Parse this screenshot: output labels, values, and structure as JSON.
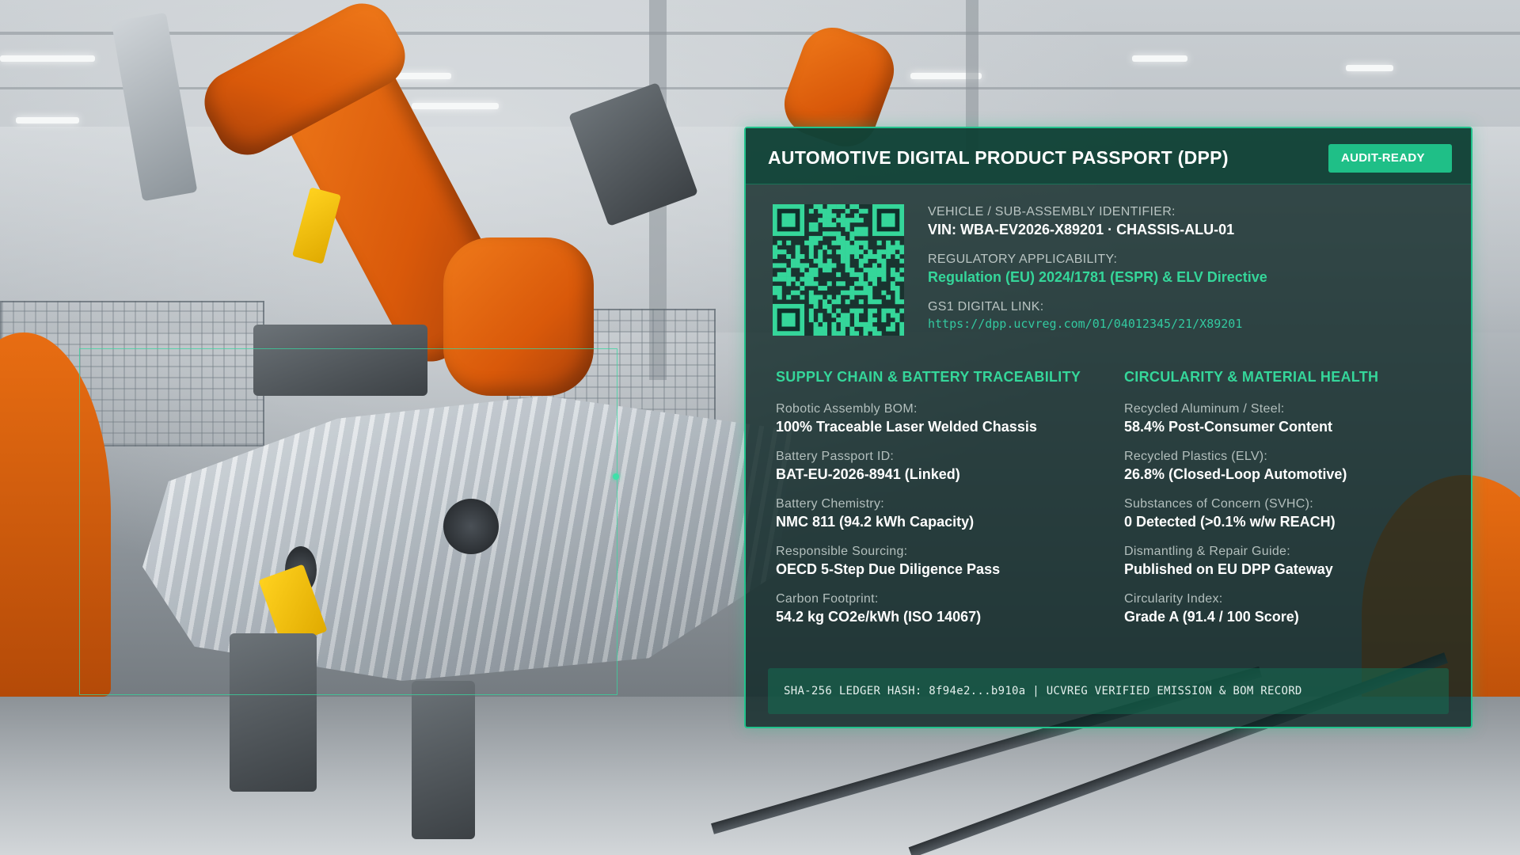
{
  "panel": {
    "title": "AUTOMOTIVE DIGITAL PRODUCT PASSPORT (DPP)",
    "badge": "AUDIT-READY",
    "identity": {
      "vehicle_label": "VEHICLE / SUB-ASSEMBLY IDENTIFIER:",
      "vehicle_value": "VIN: WBA-EV2026-X89201 · CHASSIS-ALU-01",
      "regulatory_label": "REGULATORY APPLICABILITY:",
      "regulatory_value": "Regulation (EU) 2024/1781 (ESPR) & ELV Directive",
      "gs1_label": "GS1 DIGITAL LINK:",
      "gs1_value": "https://dpp.ucvreg.com/01/04012345/21/X89201"
    },
    "supply_chain": {
      "title": "SUPPLY CHAIN & BATTERY TRACEABILITY",
      "items": [
        {
          "label": "Robotic Assembly BOM:",
          "value": "100% Traceable Laser Welded Chassis"
        },
        {
          "label": "Battery Passport ID:",
          "value": "BAT-EU-2026-8941 (Linked)"
        },
        {
          "label": "Battery Chemistry:",
          "value": "NMC 811 (94.2 kWh Capacity)"
        },
        {
          "label": "Responsible Sourcing:",
          "value": "OECD 5-Step Due Diligence Pass"
        },
        {
          "label": "Carbon Footprint:",
          "value": "54.2 kg CO2e/kWh (ISO 14067)"
        }
      ]
    },
    "circularity": {
      "title": "CIRCULARITY & MATERIAL HEALTH",
      "items": [
        {
          "label": "Recycled Aluminum / Steel:",
          "value": "58.4% Post-Consumer Content"
        },
        {
          "label": "Recycled Plastics (ELV):",
          "value": "26.8% (Closed-Loop Automotive)"
        },
        {
          "label": "Substances of Concern (SVHC):",
          "value": "0 Detected (>0.1% w/w REACH)"
        },
        {
          "label": "Dismantling & Repair Guide:",
          "value": "Published on EU DPP Gateway"
        },
        {
          "label": "Circularity Index:",
          "value": "Grade A (91.4 / 100 Score)"
        }
      ]
    },
    "ledger": "SHA-256 LEDGER HASH: 8f94e2...b910a | UCVREG VERIFIED EMISSION & BOM RECORD"
  },
  "colors": {
    "accent": "#21c38c",
    "accent_text": "#35d69a",
    "panel_bg": "#0c2624",
    "robot_orange": "#e86d12"
  },
  "icons": {
    "qr": "qr-code-icon"
  }
}
